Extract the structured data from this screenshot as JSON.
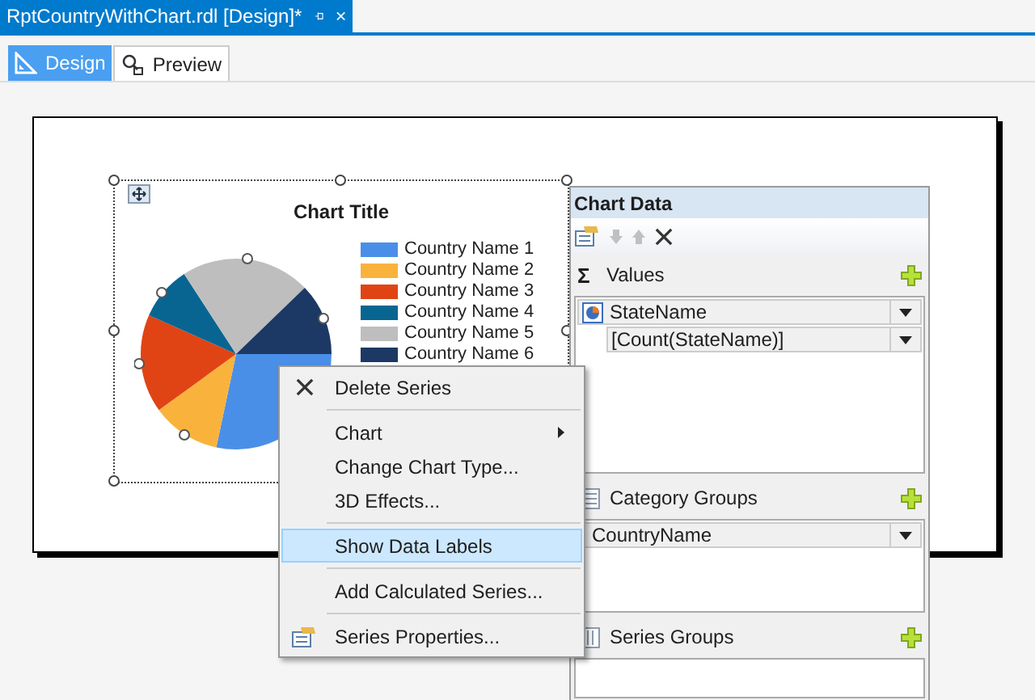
{
  "document_tab": {
    "title": "RptCountryWithChart.rdl [Design]*"
  },
  "view_tabs": [
    {
      "label": "Design",
      "kind": "design",
      "selected": true
    },
    {
      "label": "Preview",
      "kind": "preview",
      "selected": false
    }
  ],
  "chart": {
    "title": "Chart Title",
    "legend": [
      {
        "label": "Country Name 1",
        "color": "#4a8fe7"
      },
      {
        "label": "Country Name 2",
        "color": "#f9b33d"
      },
      {
        "label": "Country Name 3",
        "color": "#e04414"
      },
      {
        "label": "Country Name 4",
        "color": "#086592"
      },
      {
        "label": "Country Name 5",
        "color": "#bebebe"
      },
      {
        "label": "Country Name 6",
        "color": "#1c3864"
      }
    ]
  },
  "data_panel": {
    "title": "Chart Data",
    "sections": [
      {
        "title": "Values",
        "kind": "values",
        "symbol": "Σ",
        "fields": [
          {
            "label": "StateName",
            "kind": "series"
          },
          {
            "label": "[Count(StateName)]",
            "kind": "value"
          }
        ]
      },
      {
        "title": "Category Groups",
        "kind": "category",
        "fields": [
          {
            "label": "CountryName",
            "kind": "group"
          }
        ]
      },
      {
        "title": "Series Groups",
        "kind": "series"
      }
    ]
  },
  "context_menu": {
    "items": [
      {
        "kind": "delete",
        "label": "Delete Series",
        "submenu": false,
        "selected": false
      },
      {
        "kind": "separator"
      },
      {
        "kind": "item",
        "label": "Chart",
        "submenu": true,
        "selected": false
      },
      {
        "kind": "item",
        "label": "Change Chart Type...",
        "submenu": false,
        "selected": false
      },
      {
        "kind": "item",
        "label": "3D Effects...",
        "submenu": false,
        "selected": false
      },
      {
        "kind": "separator"
      },
      {
        "kind": "item",
        "label": "Show Data Labels",
        "submenu": false,
        "selected": true
      },
      {
        "kind": "separator"
      },
      {
        "kind": "item",
        "label": "Add Calculated Series...",
        "submenu": false,
        "selected": false
      },
      {
        "kind": "separator"
      },
      {
        "kind": "properties",
        "label": "Series Properties...",
        "submenu": false,
        "selected": false
      }
    ]
  }
}
